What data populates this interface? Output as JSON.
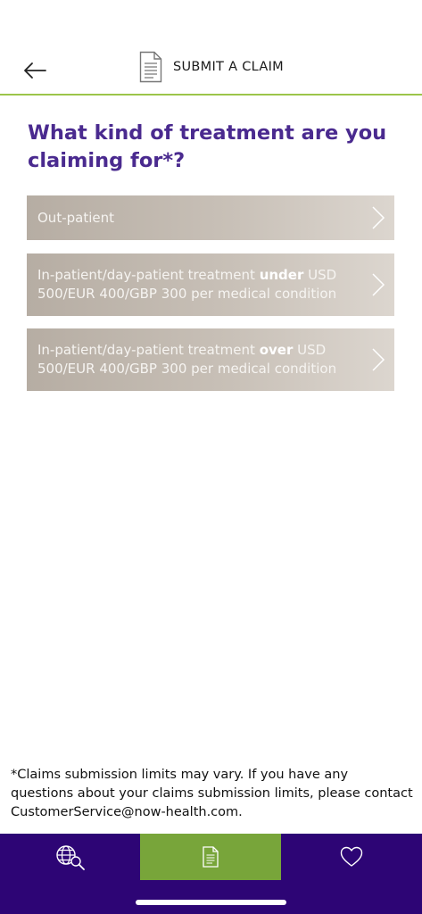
{
  "header": {
    "title": "SUBMIT A CLAIM",
    "back_icon": "arrow-left-icon",
    "title_icon": "document-icon"
  },
  "question": "What kind of treatment are you claiming for*?",
  "options": [
    {
      "text": "Out-patient"
    },
    {
      "prefix": "In-patient/day-patient treatment ",
      "emphasis": "under",
      "suffix": " USD 500/EUR 400/GBP 300 per medical condition"
    },
    {
      "prefix": "In-patient/day-patient treatment ",
      "emphasis": "over",
      "suffix": " USD 500/EUR 400/GBP 300 per medical condition"
    }
  ],
  "footnote": "*Claims submission limits may vary. If you have any questions about your claims submission limits, please contact CustomerService@now-health.com.",
  "tabbar": {
    "tabs": [
      {
        "icon": "globe-search-icon",
        "active": false
      },
      {
        "icon": "document-icon",
        "active": true
      },
      {
        "icon": "heart-icon",
        "active": false
      }
    ]
  },
  "colors": {
    "accent_purple": "#4a2a8f",
    "tabbar_bg": "#2d0575",
    "active_tab": "#78a53a",
    "header_line": "#9cc54a",
    "option_bg": "#c8c0b7"
  }
}
